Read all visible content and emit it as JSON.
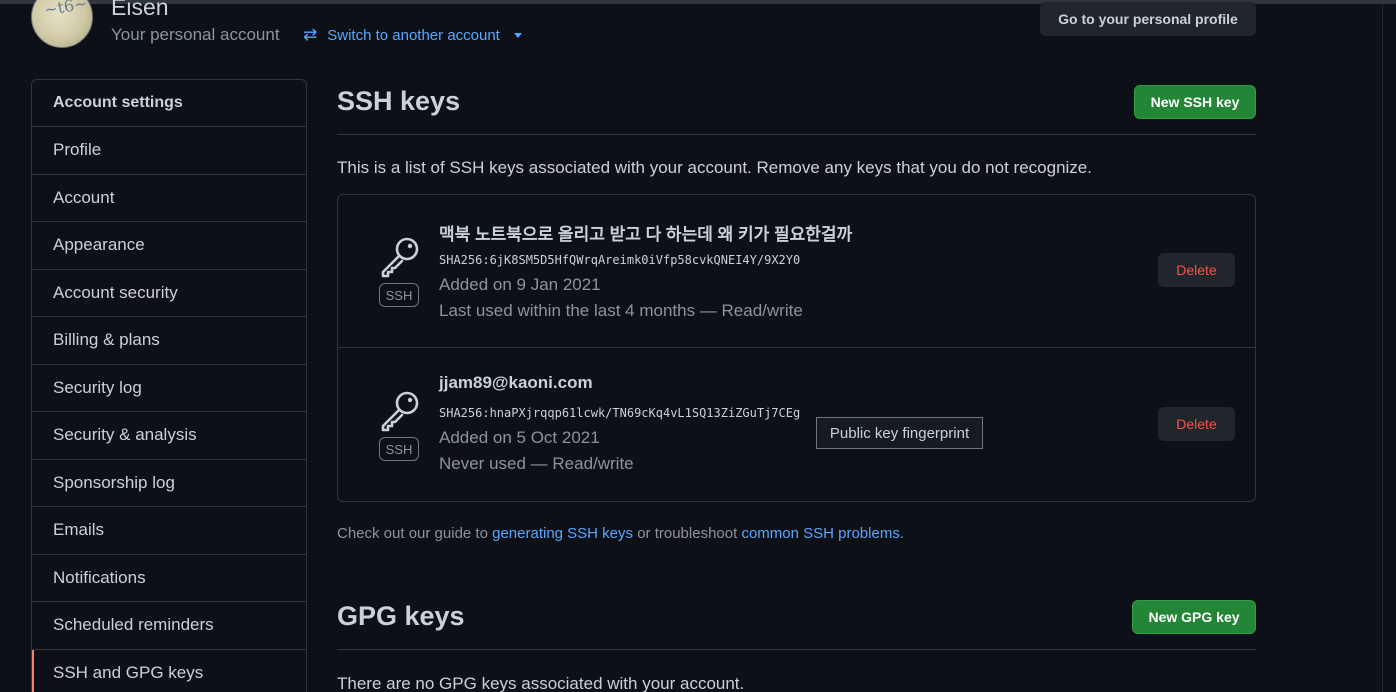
{
  "header": {
    "username": "Eisen",
    "account_label": "Your personal account",
    "switch_label": "Switch to another account",
    "profile_button": "Go to your personal profile"
  },
  "sidebar": {
    "heading": "Account settings",
    "items": [
      {
        "label": "Profile"
      },
      {
        "label": "Account"
      },
      {
        "label": "Appearance"
      },
      {
        "label": "Account security"
      },
      {
        "label": "Billing & plans"
      },
      {
        "label": "Security log"
      },
      {
        "label": "Security & analysis"
      },
      {
        "label": "Sponsorship log"
      },
      {
        "label": "Emails"
      },
      {
        "label": "Notifications"
      },
      {
        "label": "Scheduled reminders"
      },
      {
        "label": "SSH and GPG keys",
        "active": true
      }
    ]
  },
  "ssh": {
    "title": "SSH keys",
    "new_button": "New SSH key",
    "description": "This is a list of SSH keys associated with your account. Remove any keys that you do not recognize.",
    "keys": [
      {
        "title": "맥북 노트북으로 올리고 받고 다 하는데 왜 키가 필요한걸까",
        "fingerprint": "SHA256:6jK8SM5D5HfQWrqAreimk0iVfp58cvkQNEI4Y/9X2Y0",
        "added": "Added on 9 Jan 2021",
        "last_used": "Last used within the last 4 months — Read/write",
        "badge": "SSH",
        "delete_label": "Delete"
      },
      {
        "title": "jjam89@kaoni.com",
        "fingerprint": "SHA256:hnaPXjrqqp61lcwk/TN69cKq4vL1SQ13ZiZGuTj7CEg",
        "added": "Added on 5 Oct 2021",
        "last_used": "Never used — Read/write",
        "badge": "SSH",
        "delete_label": "Delete"
      }
    ],
    "tooltip": "Public key fingerprint",
    "guide": {
      "prefix": "Check out our guide to ",
      "link1": "generating SSH keys",
      "middle": " or troubleshoot ",
      "link2": "common SSH problems",
      "suffix": "."
    }
  },
  "gpg": {
    "title": "GPG keys",
    "new_button": "New GPG key",
    "empty_text": "There are no GPG keys associated with your account."
  },
  "colors": {
    "background": "#0d1117",
    "accent_green": "#238636",
    "link_blue": "#58a6ff",
    "danger_red": "#f85149",
    "active_marker": "#f78166"
  }
}
